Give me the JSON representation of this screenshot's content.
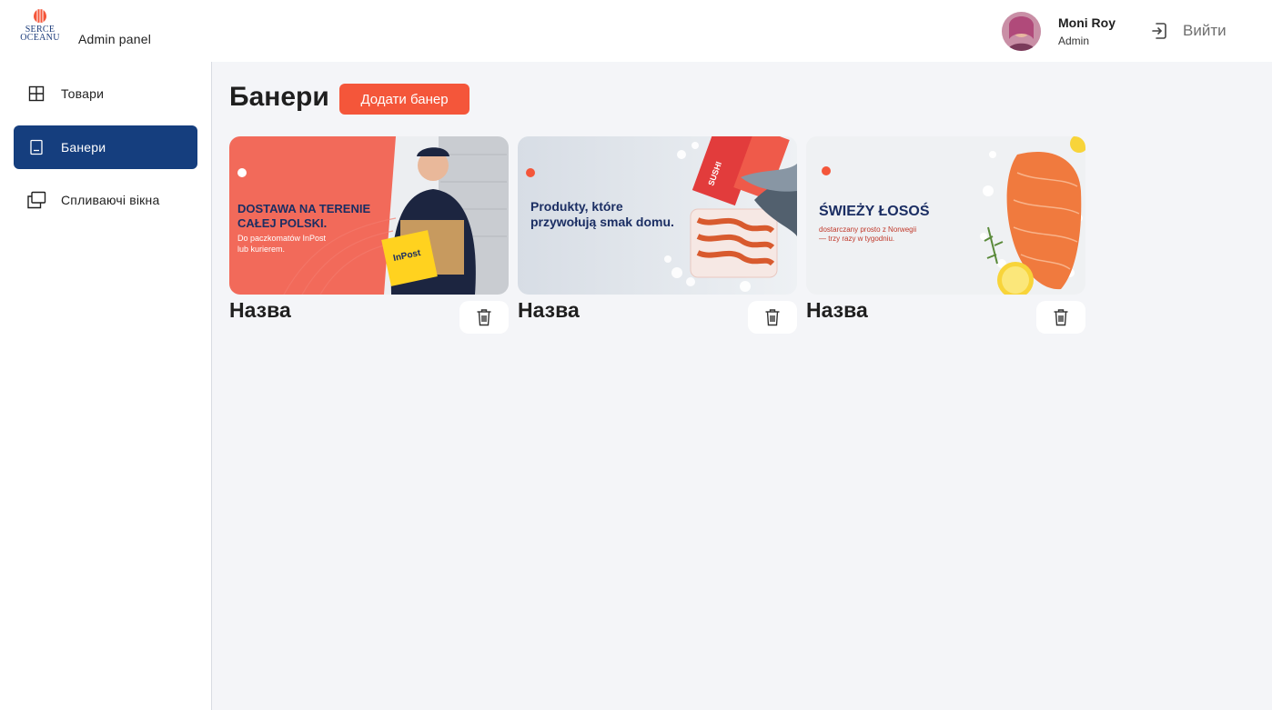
{
  "brand": {
    "logo_text_line1": "SERCE",
    "logo_text_line2": "OCEANU",
    "accent_color": "#f4563a"
  },
  "header": {
    "admin_title": "Admin panel",
    "user": {
      "name": "Moni Roy",
      "role": "Admin"
    },
    "logout_label": "Вийти",
    "logout_icon": "logout-icon"
  },
  "sidebar": {
    "items": [
      {
        "label": "Товари",
        "icon": "grid-icon",
        "active": false
      },
      {
        "label": "Банери",
        "icon": "banner-icon",
        "active": true
      },
      {
        "label": "Спливаючі вікна",
        "icon": "windows-icon",
        "active": false
      }
    ],
    "active_color": "#153e7e"
  },
  "main": {
    "title": "Банери",
    "add_button_label": "Додати банер",
    "banners": [
      {
        "name": "Назва",
        "headline_line1": "DOSTAWA NA TERENIE",
        "headline_line2": "CAŁEJ POLSKI.",
        "sub_line1": "Do paczkomatów InPost",
        "sub_line2": "lub kurierem.",
        "badge": "InPost",
        "background": "#f26a5a"
      },
      {
        "name": "Назва",
        "headline_line1": "Produkty, które",
        "headline_line2": "przywołują smak domu.",
        "badge": "SUSHI",
        "background": "#dfe4ea"
      },
      {
        "name": "Назва",
        "headline_line1": "ŚWIEŻY ŁOSOŚ",
        "sub_line1": "dostarczany prosto z Norwegii",
        "sub_line2": "— trzy razy w tygodniu.",
        "background": "#eef0f2"
      }
    ]
  }
}
